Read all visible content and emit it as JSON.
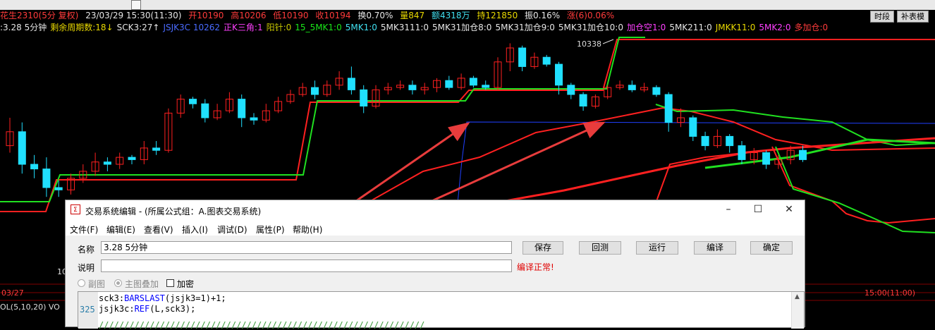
{
  "header": {
    "instrument": "花生2310(5分 复权)",
    "datetime": "23/03/29 15:30(11:30)",
    "open": "开10190",
    "high": "高10206",
    "low": "低10190",
    "close": "收10194",
    "turnover": "换0.70%",
    "volume": "量847",
    "amount": "额4318万",
    "oi": "持121850",
    "amplitude": "振0.16%",
    "change": "涨(6)0.06%",
    "btn_period": "时段",
    "btn_table": "补表模"
  },
  "indicators": [
    {
      "text": ":3.28 5分钟",
      "color": "#e6e6e6"
    },
    {
      "text": "剩余周期数:18↓",
      "color": "#e8d800"
    },
    {
      "text": "SCK3:27↑",
      "color": "#e6e6e6"
    },
    {
      "text": "JSJK3C 10262",
      "color": "#4a6bff"
    },
    {
      "text": "正K三角:1",
      "color": "#ff40ff"
    },
    {
      "text": "阳针:0",
      "color": "#c8c800"
    },
    {
      "text": "15_5MK1:0",
      "color": "#19e619"
    },
    {
      "text": "5MK1:0",
      "color": "#40e0f0"
    },
    {
      "text": "5MK3111:0",
      "color": "#e6e6e6"
    },
    {
      "text": "5MK31加仓8:0",
      "color": "#e6e6e6"
    },
    {
      "text": "5MK31加仓9:0",
      "color": "#e6e6e6"
    },
    {
      "text": "5MK31加仓10:0",
      "color": "#e6e6e6"
    },
    {
      "text": "加仓空1:0",
      "color": "#ff40ff"
    },
    {
      "text": "5MK211:0",
      "color": "#e6e6e6"
    },
    {
      "text": "JMKK11:0",
      "color": "#e8d800"
    },
    {
      "text": "5MK2:0",
      "color": "#ff40ff"
    },
    {
      "text": "多加仓:0",
      "color": "#ff3b3b"
    }
  ],
  "chart": {
    "peak_label": "10338",
    "left_label": "10",
    "date_label": "03/27",
    "time_label": "15:00(11:00)",
    "vol_label": "OL(5,10,20) VO"
  },
  "chart_data": {
    "type": "candlestick",
    "peak_marker": 10338,
    "candles": [
      {
        "o": 0.58,
        "c": 0.64,
        "h": 0.7,
        "l": 0.55
      },
      {
        "o": 0.64,
        "c": 0.5,
        "h": 0.68,
        "l": 0.46
      },
      {
        "o": 0.5,
        "c": 0.48,
        "h": 0.54,
        "l": 0.44
      },
      {
        "o": 0.48,
        "c": 0.4,
        "h": 0.53,
        "l": 0.36
      },
      {
        "o": 0.4,
        "c": 0.39,
        "h": 0.43,
        "l": 0.36
      },
      {
        "o": 0.39,
        "c": 0.44,
        "h": 0.46,
        "l": 0.37
      },
      {
        "o": 0.44,
        "c": 0.47,
        "h": 0.5,
        "l": 0.42
      },
      {
        "o": 0.47,
        "c": 0.51,
        "h": 0.55,
        "l": 0.45
      },
      {
        "o": 0.51,
        "c": 0.5,
        "h": 0.53,
        "l": 0.47
      },
      {
        "o": 0.5,
        "c": 0.53,
        "h": 0.55,
        "l": 0.48
      },
      {
        "o": 0.53,
        "c": 0.52,
        "h": 0.54,
        "l": 0.5
      },
      {
        "o": 0.52,
        "c": 0.57,
        "h": 0.6,
        "l": 0.5
      },
      {
        "o": 0.57,
        "c": 0.56,
        "h": 0.6,
        "l": 0.54
      },
      {
        "o": 0.56,
        "c": 0.72,
        "h": 0.74,
        "l": 0.55
      },
      {
        "o": 0.72,
        "c": 0.78,
        "h": 0.8,
        "l": 0.7
      },
      {
        "o": 0.78,
        "c": 0.76,
        "h": 0.79,
        "l": 0.74
      },
      {
        "o": 0.76,
        "c": 0.7,
        "h": 0.78,
        "l": 0.68
      },
      {
        "o": 0.7,
        "c": 0.73,
        "h": 0.76,
        "l": 0.69
      },
      {
        "o": 0.73,
        "c": 0.78,
        "h": 0.81,
        "l": 0.72
      },
      {
        "o": 0.78,
        "c": 0.7,
        "h": 0.8,
        "l": 0.66
      },
      {
        "o": 0.7,
        "c": 0.69,
        "h": 0.72,
        "l": 0.67
      },
      {
        "o": 0.69,
        "c": 0.73,
        "h": 0.76,
        "l": 0.68
      },
      {
        "o": 0.73,
        "c": 0.77,
        "h": 0.79,
        "l": 0.72
      },
      {
        "o": 0.77,
        "c": 0.8,
        "h": 0.82,
        "l": 0.76
      },
      {
        "o": 0.8,
        "c": 0.83,
        "h": 0.85,
        "l": 0.79
      },
      {
        "o": 0.83,
        "c": 0.8,
        "h": 0.86,
        "l": 0.78
      },
      {
        "o": 0.8,
        "c": 0.84,
        "h": 0.86,
        "l": 0.79
      },
      {
        "o": 0.84,
        "c": 0.87,
        "h": 0.9,
        "l": 0.82
      },
      {
        "o": 0.87,
        "c": 0.82,
        "h": 0.92,
        "l": 0.8
      },
      {
        "o": 0.82,
        "c": 0.75,
        "h": 0.84,
        "l": 0.72
      },
      {
        "o": 0.75,
        "c": 0.82,
        "h": 0.84,
        "l": 0.74
      },
      {
        "o": 0.82,
        "c": 0.83,
        "h": 0.85,
        "l": 0.8
      },
      {
        "o": 0.83,
        "c": 0.84,
        "h": 0.86,
        "l": 0.82
      },
      {
        "o": 0.84,
        "c": 0.82,
        "h": 0.86,
        "l": 0.8
      },
      {
        "o": 0.82,
        "c": 0.83,
        "h": 0.85,
        "l": 0.8
      },
      {
        "o": 0.83,
        "c": 0.86,
        "h": 0.87,
        "l": 0.81
      },
      {
        "o": 0.86,
        "c": 0.83,
        "h": 0.88,
        "l": 0.82
      },
      {
        "o": 0.83,
        "c": 0.87,
        "h": 0.89,
        "l": 0.82
      },
      {
        "o": 0.87,
        "c": 0.84,
        "h": 0.88,
        "l": 0.83
      },
      {
        "o": 0.84,
        "c": 0.83,
        "h": 0.86,
        "l": 0.82
      },
      {
        "o": 0.83,
        "c": 0.94,
        "h": 0.96,
        "l": 0.82
      },
      {
        "o": 0.94,
        "c": 1.0,
        "h": 1.02,
        "l": 0.9
      },
      {
        "o": 1.0,
        "c": 0.92,
        "h": 1.01,
        "l": 0.9
      },
      {
        "o": 0.92,
        "c": 0.96,
        "h": 0.98,
        "l": 0.91
      },
      {
        "o": 0.96,
        "c": 0.93,
        "h": 0.97,
        "l": 0.92
      },
      {
        "o": 0.93,
        "c": 0.84,
        "h": 0.94,
        "l": 0.8
      },
      {
        "o": 0.84,
        "c": 0.8,
        "h": 0.85,
        "l": 0.78
      },
      {
        "o": 0.8,
        "c": 0.75,
        "h": 0.81,
        "l": 0.73
      },
      {
        "o": 0.75,
        "c": 0.79,
        "h": 0.8,
        "l": 0.74
      },
      {
        "o": 0.79,
        "c": 0.83,
        "h": 0.84,
        "l": 0.78
      },
      {
        "o": 0.83,
        "c": 0.84,
        "h": 0.86,
        "l": 0.82
      },
      {
        "o": 0.84,
        "c": 0.82,
        "h": 0.86,
        "l": 0.81
      },
      {
        "o": 0.82,
        "c": 0.83,
        "h": 0.85,
        "l": 0.81
      },
      {
        "o": 0.83,
        "c": 0.8,
        "h": 0.84,
        "l": 0.79
      },
      {
        "o": 0.8,
        "c": 0.68,
        "h": 0.81,
        "l": 0.64
      },
      {
        "o": 0.68,
        "c": 0.7,
        "h": 0.74,
        "l": 0.66
      },
      {
        "o": 0.7,
        "c": 0.62,
        "h": 0.71,
        "l": 0.6
      },
      {
        "o": 0.62,
        "c": 0.58,
        "h": 0.64,
        "l": 0.56
      },
      {
        "o": 0.58,
        "c": 0.62,
        "h": 0.65,
        "l": 0.57
      },
      {
        "o": 0.62,
        "c": 0.58,
        "h": 0.63,
        "l": 0.55
      },
      {
        "o": 0.58,
        "c": 0.52,
        "h": 0.6,
        "l": 0.5
      },
      {
        "o": 0.52,
        "c": 0.55,
        "h": 0.57,
        "l": 0.5
      },
      {
        "o": 0.55,
        "c": 0.5,
        "h": 0.56,
        "l": 0.48
      },
      {
        "o": 0.5,
        "c": 0.52,
        "h": 0.54,
        "l": 0.48
      },
      {
        "o": 0.52,
        "c": 0.56,
        "h": 0.58,
        "l": 0.5
      },
      {
        "o": 0.56,
        "c": 0.52,
        "h": 0.58,
        "l": 0.51
      }
    ]
  },
  "dialog": {
    "title": "交易系统编辑 - (所属公式组：A.图表交易系统)",
    "menu": [
      "文件(F)",
      "编辑(E)",
      "查看(V)",
      "插入(I)",
      "调试(D)",
      "属性(P)",
      "帮助(H)"
    ],
    "name_label": "名称",
    "name_value": "3.28 5分钟",
    "desc_label": "说明",
    "desc_value": "",
    "buttons": {
      "save": "保存",
      "backtest": "回测",
      "run": "运行",
      "compile": "编译",
      "ok": "确定"
    },
    "compile_status": "编译正常!",
    "radio_sub": "副图",
    "radio_main": "主图叠加",
    "encrypt": "加密",
    "line_number": "325",
    "code_line1_a": "sck3:",
    "code_line1_fn": "BARSLAST",
    "code_line1_b": "(jsjk3=1)+1;",
    "code_line2_a": "jsjk3c:",
    "code_line2_fn": "REF",
    "code_line2_b": "(L,sck3);",
    "code_line3": "////////////////////////////////////////////////////////////////"
  },
  "colors": {
    "up": "#ff2020",
    "down": "#20e0ff",
    "green_line": "#20e020",
    "red_line": "#ff2020",
    "arrow": "#e83c3c"
  }
}
